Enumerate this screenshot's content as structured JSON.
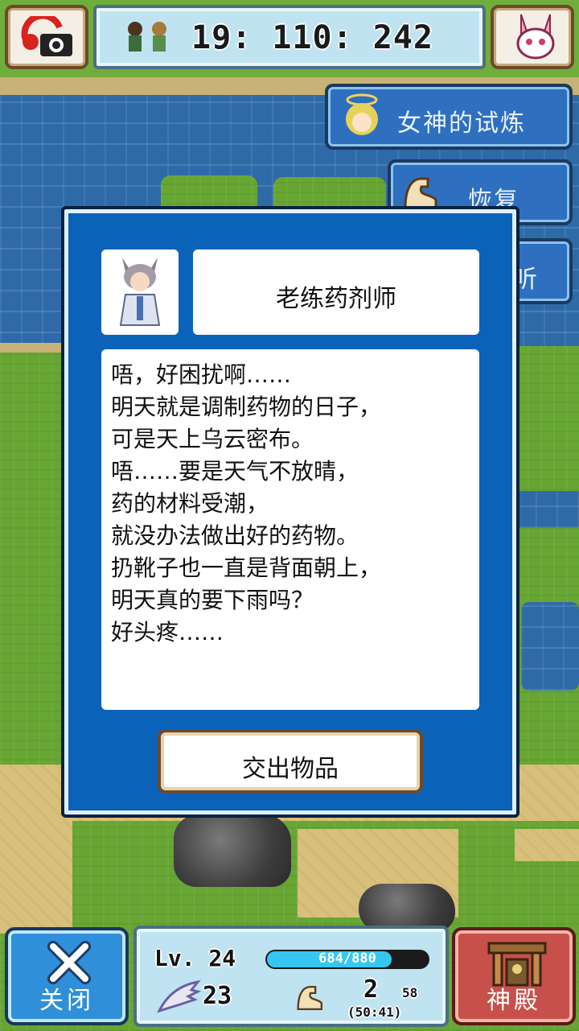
{
  "hud": {
    "time": "19: 110: 242",
    "icons": {
      "camera": "camera-icon",
      "party": "party-icon",
      "bunny": "bunny-mask-icon"
    }
  },
  "side_menu": {
    "goddess_trial": "女神的试炼",
    "recover": "恢复",
    "listen": "倾听"
  },
  "dialog": {
    "npc_name": "老练药剂师",
    "lines": [
      "唔，好困扰啊……",
      "明天就是调制药物的日子，",
      "可是天上乌云密布。",
      "唔……要是天气不放晴，",
      "药的材料受潮，",
      "就没办法做出好的药物。",
      "扔靴子也一直是背面朝上，",
      "明天真的要下雨吗？",
      "好头疼……"
    ],
    "submit_button": "交出物品"
  },
  "bottom": {
    "close_label": "关闭",
    "shrine_label": "神殿",
    "level": "Lv. 24",
    "hp_text": "684/880",
    "hp_fraction": 0.777,
    "attack": "23",
    "strength_main": "2",
    "strength_max": "58",
    "strength_sub": "(50:41)"
  },
  "colors": {
    "dialog_blue": "#0b63b9",
    "hud_blue": "#bfe3f1",
    "hp_cyan": "#36c7f0",
    "shrine_red": "#c8504a"
  }
}
